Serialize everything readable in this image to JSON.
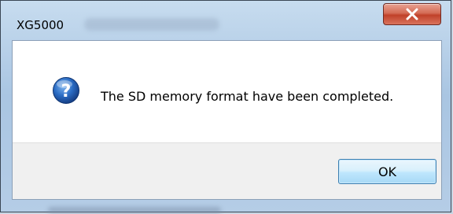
{
  "window": {
    "title": "XG5000",
    "close_icon": "close-icon"
  },
  "dialog": {
    "icon": "question-icon",
    "message": "The SD memory format have been completed.",
    "ok_label": "OK"
  },
  "colors": {
    "close_button": "#c74a35",
    "ok_border": "#3c7fb1",
    "footer_bg": "#f0f0f0",
    "icon_blue": "#1f5fb8"
  }
}
